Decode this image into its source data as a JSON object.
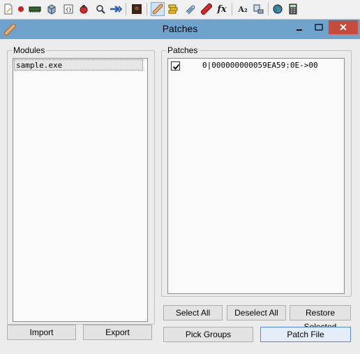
{
  "toolbar": {
    "icons": [
      "new-icon",
      "record-icon",
      "memory-icon",
      "cube-icon",
      "script-icon",
      "bug-icon",
      "search-icon",
      "arrow-icon",
      "image-icon",
      "patch-icon",
      "layers-icon",
      "clip-icon",
      "eraser-icon",
      "fx-icon",
      "font-icon",
      "computer-icon",
      "globe-icon",
      "calculator-icon"
    ],
    "fx_label": "fx",
    "font_label": "A₂"
  },
  "window": {
    "title": "Patches",
    "close_label": "✕"
  },
  "modules": {
    "label": "Modules",
    "items": [
      "sample.exe"
    ]
  },
  "patches": {
    "label": "Patches",
    "items": [
      {
        "checked": true,
        "text": "0|000000000059EA59:0E->00"
      }
    ]
  },
  "buttons": {
    "import": "Import",
    "export": "Export",
    "select_all": "Select All",
    "deselect_all": "Deselect All",
    "restore_selected": "Restore Selected",
    "pick_groups": "Pick Groups",
    "patch_file": "Patch File"
  },
  "colors": {
    "titlebar": "#6fa3cc",
    "close": "#c74b3d",
    "accent": "#4d8ccf"
  }
}
